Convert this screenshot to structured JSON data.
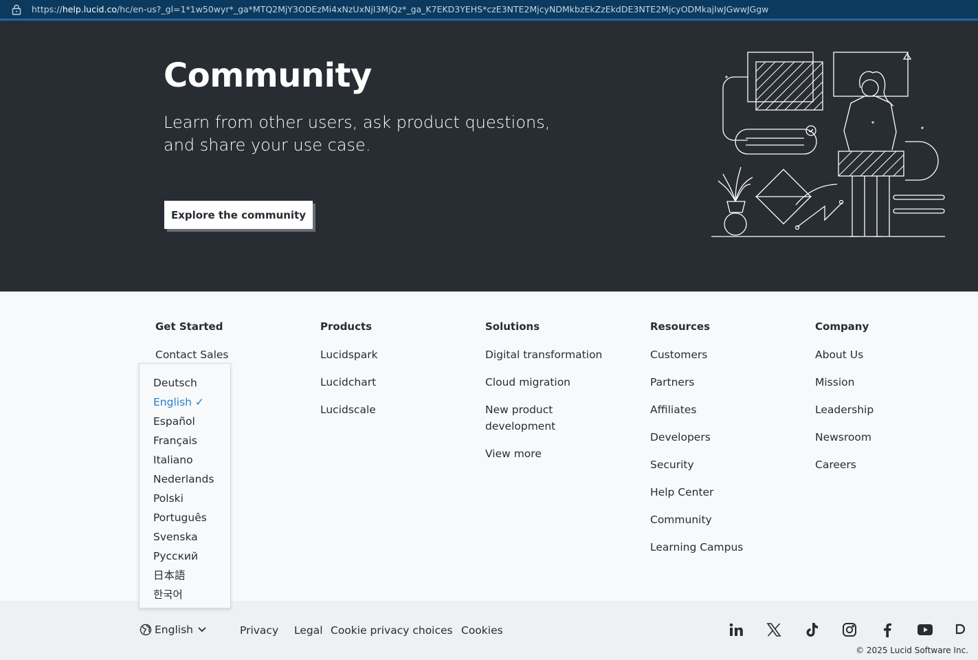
{
  "browser": {
    "url_prefix": "https://",
    "url_host": "help.lucid.co",
    "url_rest": "/hc/en-us?_gl=1*1w50wyr*_ga*MTQ2MjY3ODEzMi4xNzUxNjI3MjQz*_ga_K7EKD3YEHS*czE3NTE2MjcyNDMkbzEkZzEkdDE3NTE2MjcyODMkajIwJGwwJGgw",
    "lock_icon": "lock-icon"
  },
  "hero": {
    "title": "Community",
    "subtitle": "Learn from other users, ask product questions, and share your use case.",
    "button_label": "Explore the community"
  },
  "footer": {
    "columns": [
      {
        "heading": "Get Started",
        "items": [
          "Contact Sales"
        ]
      },
      {
        "heading": "Products",
        "items": [
          "Lucidspark",
          "Lucidchart",
          "Lucidscale"
        ]
      },
      {
        "heading": "Solutions",
        "items": [
          "Digital transformation",
          "Cloud migration",
          "New product development",
          "View more"
        ]
      },
      {
        "heading": "Resources",
        "items": [
          "Customers",
          "Partners",
          "Affiliates",
          "Developers",
          "Security",
          "Help Center",
          "Community",
          "Learning Campus"
        ]
      },
      {
        "heading": "Company",
        "items": [
          "About Us",
          "Mission",
          "Leadership",
          "Newsroom",
          "Careers"
        ]
      }
    ]
  },
  "language_menu": {
    "options": [
      "Deutsch",
      "English ✓",
      "Español",
      "Français",
      "Italiano",
      "Nederlands",
      "Polski",
      "Português",
      "Svenska",
      "Русский",
      "日本語",
      "한국어"
    ],
    "selected_index": 1,
    "accent_color": "#2a7fc9"
  },
  "bottom_bar": {
    "language_label": "English",
    "links": [
      "Privacy",
      "Legal",
      "Cookie privacy choices",
      "Cookies"
    ],
    "social_icons": [
      "linkedin-icon",
      "x-icon",
      "tiktok-icon",
      "instagram-icon",
      "facebook-icon",
      "youtube-icon",
      "lucid-icon"
    ],
    "copyright": "© 2025 Lucid Software Inc."
  },
  "colors": {
    "hero_bg": "#282c33",
    "page_bg": "#f7f9fb",
    "bottom_bg": "#eef0f2",
    "url_bar_bg": "#0b3a5e"
  }
}
